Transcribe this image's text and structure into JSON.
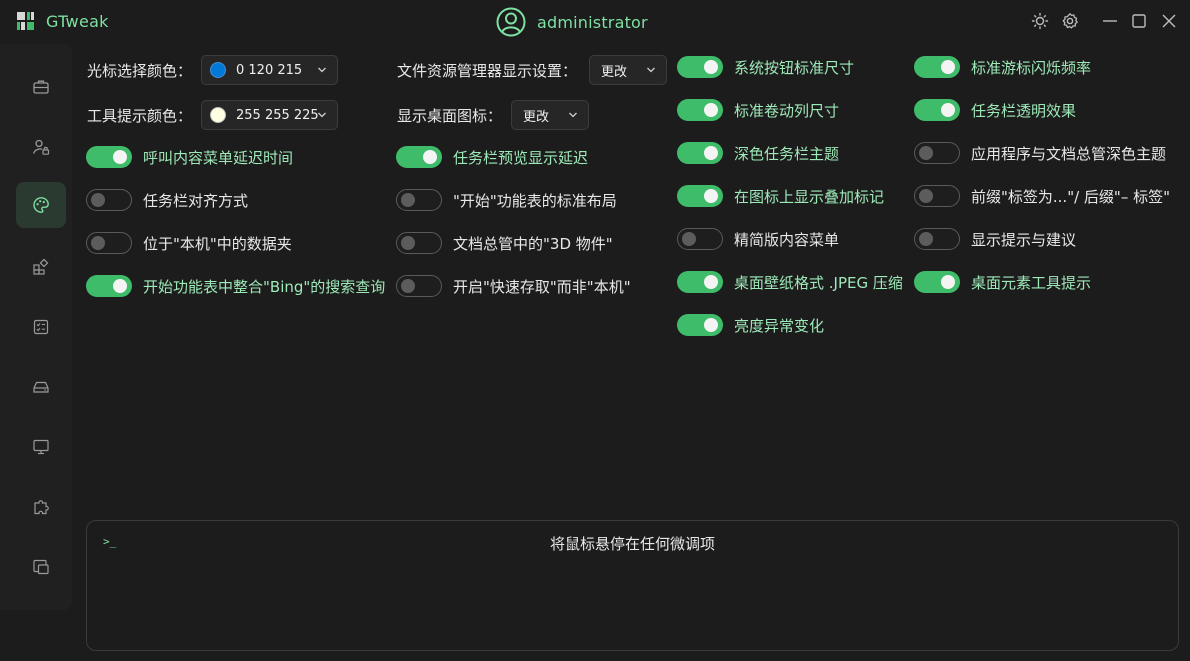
{
  "app": {
    "title": "GTweak",
    "user": "administrator"
  },
  "colors": {
    "accent": "#3ebc6a",
    "accent_text": "#7ee0a2",
    "label_on": "#9ee9b8"
  },
  "cursor_color": {
    "label": "光标选择颜色：",
    "value": "0 120 215",
    "swatch": "#0078d7"
  },
  "tooltip_color": {
    "label": "工具提示颜色：",
    "value": "255 255 225",
    "swatch": "#ffffe1"
  },
  "explorer_display": {
    "label": "文件资源管理器显示设置：",
    "button": "更改"
  },
  "desktop_icons": {
    "label": "显示桌面图标：",
    "button": "更改"
  },
  "settings": [
    {
      "label": "呼叫内容菜单延迟时间",
      "on": true
    },
    {
      "label": "任务栏对齐方式",
      "on": false
    },
    {
      "label": "位于\"本机\"中的数据夹",
      "on": false
    },
    {
      "label": "开始功能表中整合\"Bing\"的搜索查询",
      "on": true
    },
    {
      "label": "任务栏预览显示延迟",
      "on": true
    },
    {
      "label": "\"开始\"功能表的标准布局",
      "on": false
    },
    {
      "label": "文档总管中的\"3D 物件\"",
      "on": false
    },
    {
      "label": "开启\"快速存取\"而非\"本机\"",
      "on": false
    },
    {
      "label": "系统按钮标准尺寸",
      "on": true
    },
    {
      "label": "标准卷动列尺寸",
      "on": true
    },
    {
      "label": "深色任务栏主题",
      "on": true
    },
    {
      "label": "在图标上显示叠加标记",
      "on": true
    },
    {
      "label": "精简版内容菜单",
      "on": false
    },
    {
      "label": "桌面壁纸格式 .JPEG 压缩",
      "on": true
    },
    {
      "label": "亮度异常变化",
      "on": true
    },
    {
      "label": "标准游标闪烁频率",
      "on": true
    },
    {
      "label": "任务栏透明效果",
      "on": true
    },
    {
      "label": "应用程序与文档总管深色主题",
      "on": false
    },
    {
      "label": "前缀\"标签为...\"/ 后缀\"– 标签\"",
      "on": false
    },
    {
      "label": "显示提示与建议",
      "on": false
    },
    {
      "label": "桌面元素工具提示",
      "on": true
    }
  ],
  "console": {
    "prompt": ">_",
    "text": "将鼠标悬停在任何微调项"
  },
  "icons": {
    "logo": "gtweak-logo-icon",
    "user": "user-avatar-icon",
    "theme": "sun-icon",
    "settings": "gear-icon",
    "minimize": "minimize-icon",
    "maximize": "maximize-icon",
    "close": "close-icon"
  }
}
